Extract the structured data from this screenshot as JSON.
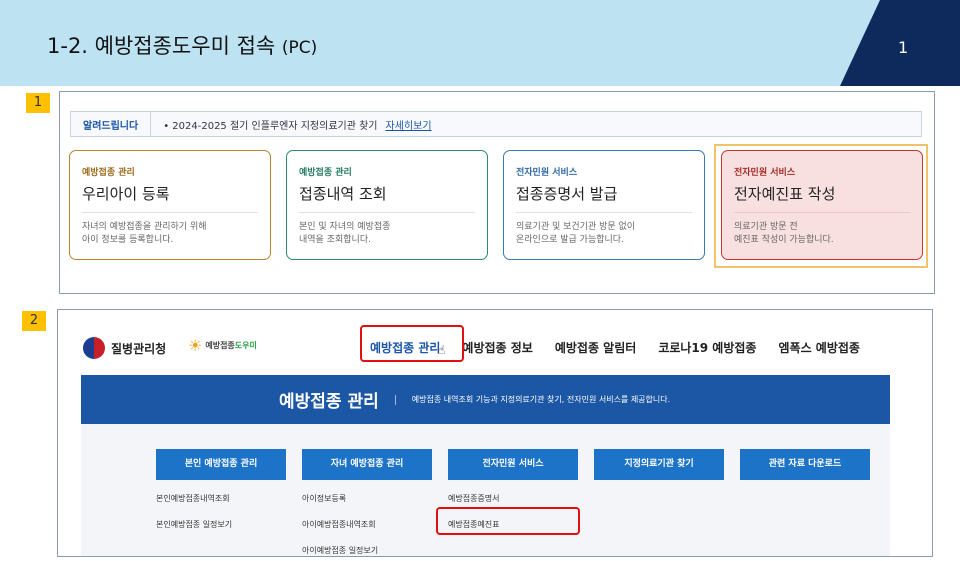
{
  "slide": {
    "title": "1-2. 예방접종도우미 접속",
    "title_suffix": "(PC)",
    "page_number": "1",
    "badge1": "1",
    "badge2": "2"
  },
  "colors": {
    "header_light": "#bde3f2",
    "header_dark": "#0e2a5c",
    "badge": "#ffc000",
    "highlight_red": "#e01010",
    "brand_blue": "#1c57a5",
    "menu_blue": "#1c73c7"
  },
  "panel1": {
    "notice_tag": "알려드립니다",
    "notice_text": "• 2024-2025 절기 인플루엔자 지정의료기관 찾기",
    "notice_link": "자세히보기",
    "cards": [
      {
        "category": "예방접종 관리",
        "title": "우리아이 등록",
        "desc": "자녀의 예방접종을 관리하기 위해\n아이 정보를 등록합니다."
      },
      {
        "category": "예방접종 관리",
        "title": "접종내역 조회",
        "desc": "본인 및 자녀의 예방접종\n내역을 조회합니다."
      },
      {
        "category": "전자민원 서비스",
        "title": "접종증명서 발급",
        "desc": "의료기관 및 보건기관 방문 없이\n온라인으로 발급 가능합니다."
      },
      {
        "category": "전자민원 서비스",
        "title": "전자예진표 작성",
        "desc": "의료기관 방문 전\n예진표 작성이 가능합니다."
      }
    ]
  },
  "panel2": {
    "logo_kdca": "질병관리청",
    "logo_vacc_a": "예방접종",
    "logo_vacc_b": "도우미",
    "nav": [
      "예방접종 관리",
      "예방접종 정보",
      "예방접종 알림터",
      "코로나19 예방접종",
      "엠폭스 예방접종"
    ],
    "banner_title": "예방접종 관리",
    "banner_desc": "예방접종 내역조회 기능과 지정의료기관 찾기, 전자민원 서비스를 제공합니다.",
    "menu_buttons": [
      "본인 예방접종 관리",
      "자녀 예방접종 관리",
      "전자민원 서비스",
      "지정의료기관 찾기",
      "관련 자료 다운로드"
    ],
    "col1": [
      "본인예방접종내역조회",
      "본인예방접종 일정보기"
    ],
    "col2": [
      "아이정보등록",
      "아이예방접종내역조회",
      "아이예방접종 일정보기"
    ],
    "col3": [
      "예방접종증명서",
      "예방접종예진표"
    ]
  }
}
